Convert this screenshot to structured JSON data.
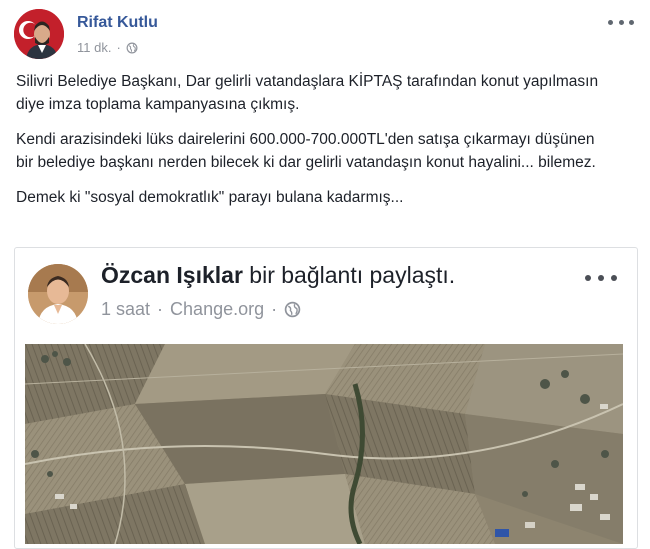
{
  "post": {
    "author": "Rifat Kutlu",
    "time": "11 dk.",
    "separator": "·",
    "privacy_icon": "globe-icon",
    "paragraphs": [
      "Silivri Belediye Başkanı, Dar gelirli vatandaşlara KİPTAŞ tarafından konut yapılmasın diye imza toplama kampanyasına çıkmış.",
      "Kendi arazisindeki lüks dairelerini 600.000-700.000TL'den satışa çıkarmayı düşünen bir belediye başkanı nerden bilecek ki dar gelirli vatandaşın konut hayalini... bilemez.",
      "Demek ki \"sosyal demokratlık\" parayı bulana kadarmış..."
    ]
  },
  "shared": {
    "author": "Özcan Işıklar",
    "action": " bir bağlantı paylaştı.",
    "time": "1 saat",
    "sep1": "·",
    "source": "Change.org",
    "sep2": "·",
    "privacy_icon": "globe-icon"
  },
  "colors": {
    "link": "#365899",
    "meta": "#90949c",
    "text": "#1d2129",
    "flag_red": "#c3202b"
  }
}
